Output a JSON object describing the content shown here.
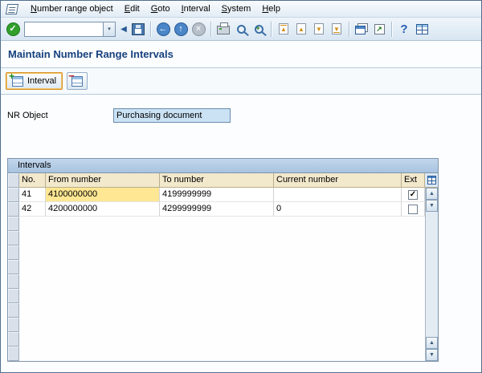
{
  "menu": {
    "items": [
      "Number range object",
      "Edit",
      "Goto",
      "Interval",
      "System",
      "Help"
    ]
  },
  "toolbar": {
    "command_field": {
      "value": ""
    },
    "glyphs": {
      "enter": "✓",
      "dropdown": "▾",
      "collapse": "◀",
      "back": "←",
      "exit": "↑",
      "cancel": "×",
      "find_plus": "+",
      "first_page": "▲",
      "page_up": "▲",
      "page_down": "▼",
      "last_page": "▼",
      "shortcut": "↗",
      "help": "?"
    }
  },
  "page_title": "Maintain Number Range Intervals",
  "app_toolbar": {
    "interval_button_label": "Interval"
  },
  "form": {
    "nr_object_label": "NR Object",
    "nr_object_value": "Purchasing document"
  },
  "intervals_table": {
    "caption": "Intervals",
    "columns": [
      "No.",
      "From number",
      "To number",
      "Current number",
      "Ext"
    ],
    "rows": [
      {
        "no": "41",
        "from": "4100000000",
        "to": "4199999999",
        "current": "",
        "ext_checked": true,
        "selected_cell": "from"
      },
      {
        "no": "42",
        "from": "4200000000",
        "to": "4299999999",
        "current": "0",
        "ext_checked": false,
        "selected_cell": ""
      }
    ]
  },
  "scrollbar": {
    "up": "▲",
    "down": "▼"
  },
  "colors": {
    "title_text": "#17417e",
    "selected_cell": "#ffe793",
    "header_fill": "#f2e8cc",
    "caption_fill": "#b4cce6",
    "field_fill": "#cbe2f5"
  }
}
